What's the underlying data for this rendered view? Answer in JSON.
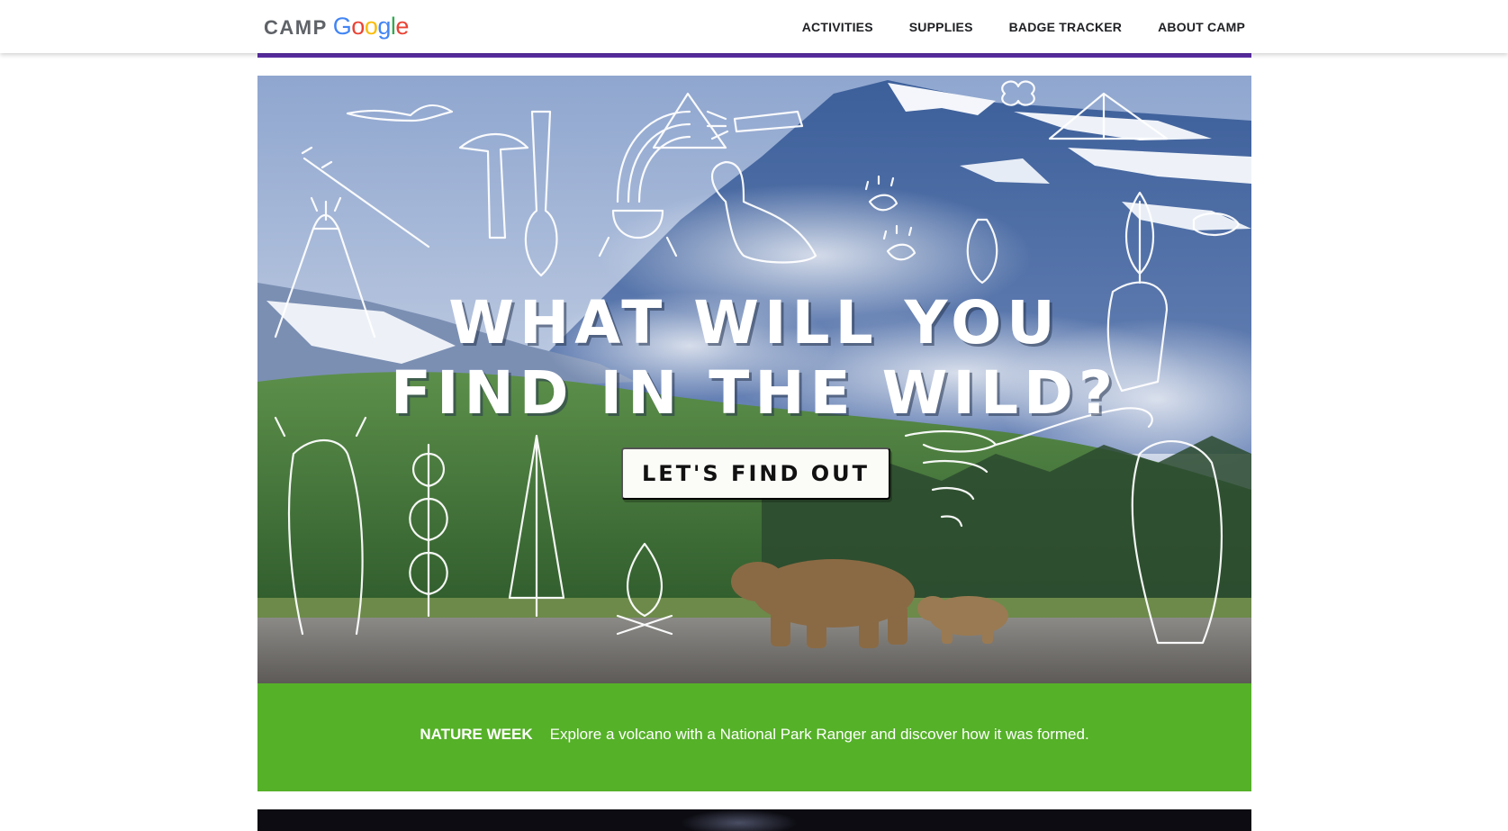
{
  "header": {
    "logo": {
      "prefix": "CAMP",
      "wordmark_letters": [
        {
          "char": "G",
          "color": "#4285F4"
        },
        {
          "char": "o",
          "color": "#EA4335"
        },
        {
          "char": "o",
          "color": "#FBBC05"
        },
        {
          "char": "g",
          "color": "#4285F4"
        },
        {
          "char": "l",
          "color": "#34A853"
        },
        {
          "char": "e",
          "color": "#EA4335"
        }
      ]
    },
    "nav": [
      {
        "label": "ACTIVITIES"
      },
      {
        "label": "SUPPLIES"
      },
      {
        "label": "BADGE TRACKER"
      },
      {
        "label": "ABOUT CAMP"
      }
    ]
  },
  "hero": {
    "headline_line1": "WHAT WILL YOU",
    "headline_line2": "FIND IN THE WILD?",
    "cta_label": "LET'S FIND OUT"
  },
  "banner": {
    "tag": "NATURE WEEK",
    "text": "Explore a volcano with a National Park Ranger and discover how it was formed."
  },
  "colors": {
    "accent_bar": "#5b2ea6",
    "banner_green": "#55b128"
  }
}
